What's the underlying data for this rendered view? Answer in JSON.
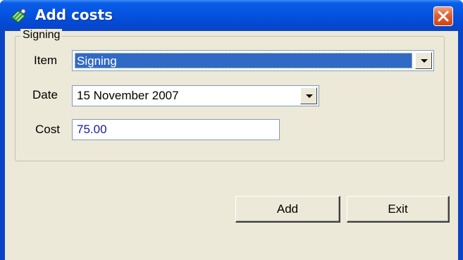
{
  "window": {
    "title": "Add costs",
    "close_icon": "close-x-icon",
    "app_icon": "costs-app-icon"
  },
  "group": {
    "title": "Signing"
  },
  "form": {
    "item_label": "Item",
    "item_value": "Signing",
    "date_label": "Date",
    "date_value": "15 November 2007",
    "cost_label": "Cost",
    "cost_value": "75.00"
  },
  "buttons": {
    "add_label": "Add",
    "exit_label": "Exit"
  },
  "colors": {
    "titlebar": "#0553e0",
    "close_button": "#e0602f",
    "selection": "#316ac5",
    "dialog_background": "#ece9d8",
    "cost_text": "#1a1aa0"
  }
}
